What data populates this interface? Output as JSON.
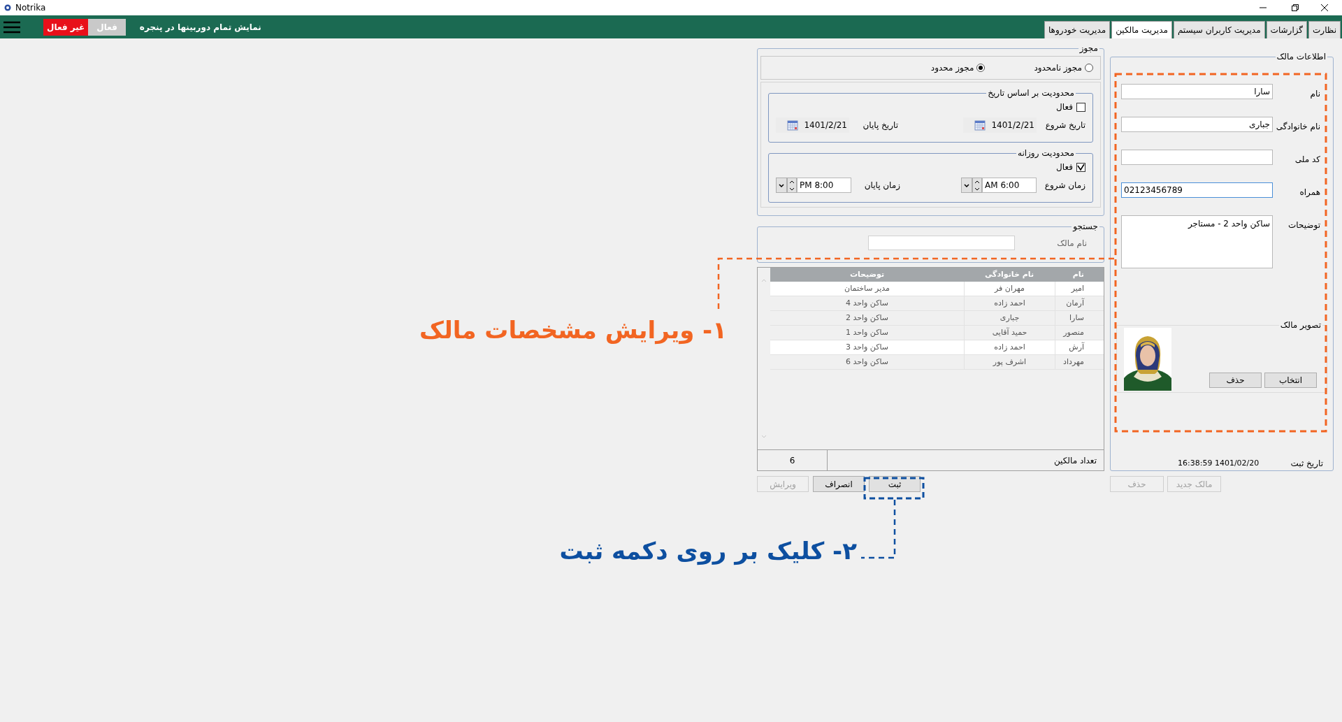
{
  "window": {
    "title": "Notrika"
  },
  "toolbar": {
    "caption": "نمایش تمام دوربینها در پنجره",
    "toggle": [
      {
        "label": "فعال",
        "selected": false
      },
      {
        "label": "غیر فعال",
        "selected": true
      }
    ]
  },
  "tabs": [
    {
      "label": "نظارت",
      "selected": false
    },
    {
      "label": "گزارشات",
      "selected": false
    },
    {
      "label": "مدیریت کاربران سیستم",
      "selected": false
    },
    {
      "label": "مدیریت مالکین",
      "selected": true
    },
    {
      "label": "مدیریت خودروها",
      "selected": false
    }
  ],
  "owner_info": {
    "title": "اطلاعات مالک",
    "fields": [
      {
        "label": "نام",
        "value": "سارا",
        "kind": "text",
        "focused": false
      },
      {
        "label": "نام خانوادگی",
        "value": "جباری",
        "kind": "text",
        "focused": false
      },
      {
        "label": "کد ملی",
        "kind": "text",
        "focused": false
      },
      {
        "label": "همراه",
        "value": "02123456789",
        "kind": "number",
        "focused": true
      },
      {
        "label": "توضیحات",
        "value": "ساکن واحد 2 - مستاجر",
        "kind": "textarea",
        "focused": false
      }
    ],
    "photo": {
      "title": "تصویر مالک",
      "buttons": [
        "انتخاب",
        "حذف"
      ]
    },
    "registered": {
      "label": "تاریخ ثبت",
      "value": "16:38:59 1401/02/20"
    }
  },
  "owner_buttons": [
    {
      "label": "مالک جدید",
      "disabled": true
    },
    {
      "label": "حذف",
      "disabled": true
    }
  ],
  "permit": {
    "title": "مجوز",
    "options": [
      {
        "label": "مجوز نامحدود",
        "selected": false
      },
      {
        "label": "مجوز محدود",
        "selected": true
      }
    ],
    "date_limit": {
      "title": "محدودیت بر اساس تاریخ",
      "active": {
        "label": "فعال",
        "checked": false
      },
      "start": {
        "label": "تاریخ شروع",
        "value": "1401/2/21"
      },
      "end": {
        "label": "تاریخ پایان",
        "value": "1401/2/21"
      }
    },
    "daily_limit": {
      "title": "محدودیت روزانه",
      "active": {
        "label": "فعال",
        "checked": true
      },
      "start": {
        "label": "زمان شروع",
        "value": "AM 6:00"
      },
      "end": {
        "label": "زمان پایان",
        "value": "PM 8:00"
      }
    }
  },
  "search": {
    "title": "جستجو",
    "label": "نام مالک"
  },
  "table": {
    "columns": [
      "نام",
      "نام خانوادگی",
      "توضیحات"
    ],
    "rows": [
      {
        "cells": [
          "امیر",
          "مهران فر",
          "مدیر ساختمان"
        ],
        "selected": true
      },
      {
        "cells": [
          "آرمان",
          "احمد زاده",
          "ساکن واحد 4"
        ],
        "selected": false
      },
      {
        "cells": [
          "سارا",
          "جباری",
          "ساکن واحد 2"
        ],
        "selected": false
      },
      {
        "cells": [
          "منصور",
          "حمید آقایی",
          "ساکن واحد 1"
        ],
        "selected": false
      },
      {
        "cells": [
          "آرش",
          "احمد زاده",
          "ساکن واحد 3"
        ],
        "selected": true
      },
      {
        "cells": [
          "مهرداد",
          "اشرف پور",
          "ساکن واحد 6"
        ],
        "selected": false
      }
    ],
    "count": {
      "label": "تعداد مالکین",
      "value": "6"
    }
  },
  "actions": [
    {
      "label": "ثبت",
      "disabled": false
    },
    {
      "label": "انصراف",
      "disabled": false
    },
    {
      "label": "ویرایش",
      "disabled": true
    }
  ],
  "annotations": [
    {
      "text": "۱- ویرایش مشخصات مالک",
      "color": "#f26522"
    },
    {
      "text": "۲- کلیک بر روی دکمه ثبت",
      "color": "#0d4fa0"
    }
  ]
}
